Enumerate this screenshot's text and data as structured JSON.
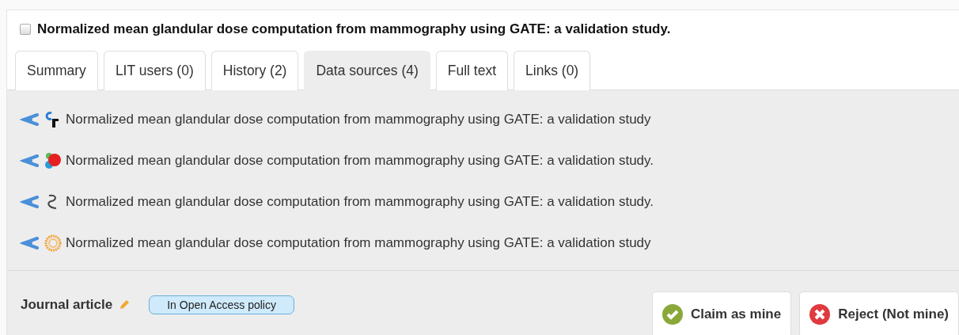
{
  "record": {
    "title": "Normalized mean glandular dose computation from mammography using GATE: a validation study.",
    "checked": false
  },
  "tabs": [
    {
      "label": "Summary",
      "selected": false
    },
    {
      "label": "LIT users (0)",
      "selected": false
    },
    {
      "label": "History (2)",
      "selected": false
    },
    {
      "label": "Data sources (4)",
      "selected": true
    },
    {
      "label": "Full text",
      "selected": false
    },
    {
      "label": "Links (0)",
      "selected": false
    }
  ],
  "sources": [
    {
      "kind": "crossref",
      "title": "Normalized mean glandular dose computation from mammography using GATE: a validation study"
    },
    {
      "kind": "dots",
      "title": "Normalized mean glandular dose computation from mammography using GATE: a validation study."
    },
    {
      "kind": "squiggle",
      "title": "Normalized mean glandular dose computation from mammography using GATE: a validation study."
    },
    {
      "kind": "ring",
      "title": "Normalized mean glandular dose computation from mammography using GATE: a validation study"
    }
  ],
  "footer": {
    "type": "Journal article",
    "badge": "In Open Access policy",
    "buttons": [
      {
        "kind": "claim",
        "label": "Claim as mine"
      },
      {
        "kind": "reject",
        "label": "Reject (Not mine)"
      }
    ]
  }
}
